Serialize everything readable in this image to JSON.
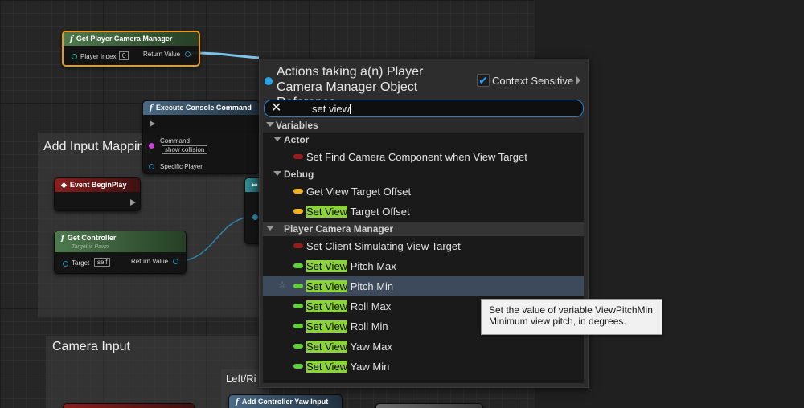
{
  "graph": {
    "comments": {
      "add_input_mapping": "Add Input Mapping",
      "camera_input": "Camera Input",
      "left_right_partial": "Left/Ri"
    },
    "nodes": {
      "get_camera_manager": {
        "title": "Get Player Camera Manager",
        "fn_glyph": "f",
        "pin_player_index": "Player Index",
        "player_index_value": "0",
        "pin_return_value": "Return Value"
      },
      "execute_console": {
        "title": "Execute Console Command",
        "fn_glyph": "f",
        "pin_command": "Command",
        "command_value": "show collision",
        "pin_specific_player": "Specific Player"
      },
      "event_begin_play": {
        "title": "Event BeginPlay"
      },
      "get_controller": {
        "title": "Get Controller",
        "fn_glyph": "f",
        "subtitle": "Target is Pawn",
        "pin_target": "Target",
        "target_value": "self",
        "pin_return_value": "Return Value"
      },
      "add_yaw_input": {
        "title": "Add Controller Yaw Input",
        "fn_glyph": "f"
      }
    }
  },
  "menu": {
    "title": "Actions taking a(n) Player Camera Manager Object Reference",
    "context_label": "Context Sensitive",
    "context_checked": true,
    "check_glyph": "✔",
    "clear_glyph": "✕",
    "search_value": "set view",
    "star_glyph": "☆",
    "categories": {
      "variables": "Variables",
      "actor": "Actor",
      "debug": "Debug",
      "player_camera_manager": "Player Camera Manager"
    },
    "items": [
      {
        "highlight": "",
        "rest": "Set Find Camera Component when View Target",
        "color": "#9b1b1b"
      },
      {
        "highlight": "",
        "rest": "Get View Target Offset",
        "color": "#f0b21c"
      },
      {
        "highlight": "Set View",
        "rest": " Target Offset",
        "color": "#f0b21c"
      },
      {
        "highlight": "",
        "rest": "Set Client Simulating View Target",
        "color": "#9b1b1b"
      },
      {
        "highlight": "Set View",
        "rest": " Pitch Max",
        "color": "#5fd03a"
      },
      {
        "highlight": "Set View",
        "rest": " Pitch Min",
        "color": "#5fd03a"
      },
      {
        "highlight": "Set View",
        "rest": " Roll Max",
        "color": "#5fd03a"
      },
      {
        "highlight": "Set View",
        "rest": " Roll Min",
        "color": "#5fd03a"
      },
      {
        "highlight": "Set View",
        "rest": " Yaw Max",
        "color": "#5fd03a"
      },
      {
        "highlight": "Set View",
        "rest": " Yaw Min",
        "color": "#5fd03a"
      }
    ]
  },
  "tooltip": {
    "line1": "Set the value of variable ViewPitchMin",
    "line2": "Minimum view pitch, in degrees."
  },
  "colors": {
    "wire_blue": "#2b84a8",
    "wire_selected": "#7cc4ea",
    "accent": "#29a3e8",
    "highlight": "#8cd23a"
  }
}
